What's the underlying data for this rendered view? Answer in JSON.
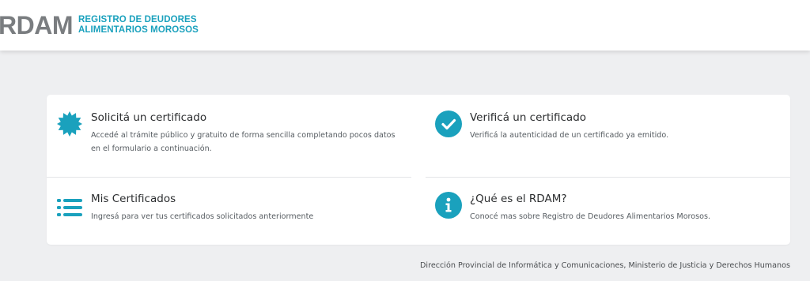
{
  "header": {
    "logo_mark": "RDAM",
    "logo_line1": "REGISTRO DE DEUDORES",
    "logo_line2": "ALIMENTARIOS MOROSOS"
  },
  "menu": {
    "items": [
      {
        "title": "Solicitá un certificado",
        "desc_line1": "Accedé al trámite público y gratuito de forma sencilla completando pocos datos",
        "desc_line2": "en el formulario a continuación.",
        "icon": "badge-icon"
      },
      {
        "title": "Verificá un certificado",
        "desc_line1": "Verificá la autenticidad de un certificado ya emitido.",
        "icon": "check-circle-icon"
      },
      {
        "title": "Mis Certificados",
        "desc_line1": "Ingresá para ver tus certificados solicitados anteriormente",
        "icon": "list-icon"
      },
      {
        "title": "¿Qué es el RDAM?",
        "desc_line1": "Conocé mas sobre Registro de Deudores Alimentarios Morosos.",
        "icon": "info-circle-icon"
      }
    ]
  },
  "footer": {
    "text": "Dirección Provincial de Informática y Comunicaciones, Ministerio de Justicia y Derechos Humanos"
  },
  "colors": {
    "accent": "#1aa1bd",
    "background": "#eeeff1",
    "logo_gray": "#7a7d80"
  }
}
